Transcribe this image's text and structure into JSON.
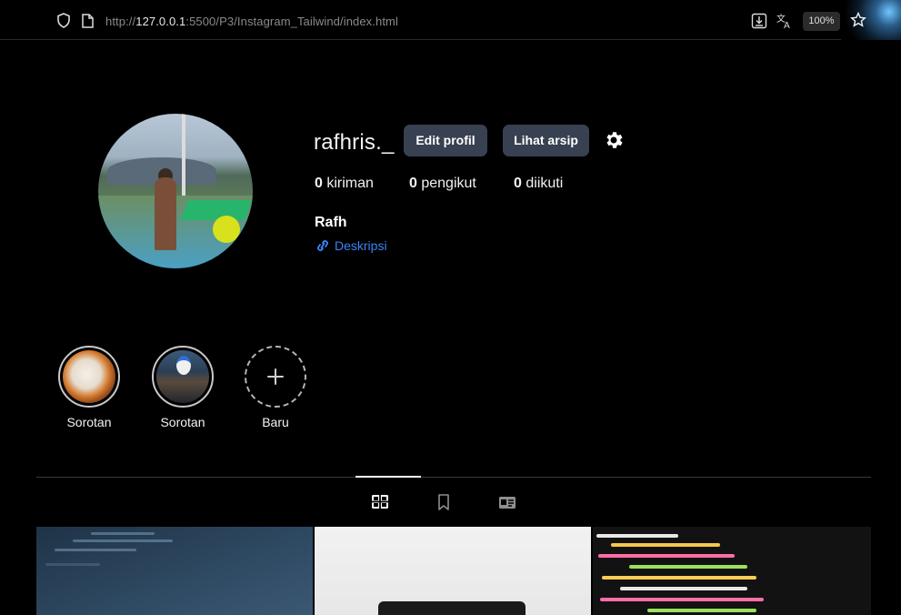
{
  "browser": {
    "url_prefix": "http://",
    "url_host": "127.0.0.1",
    "url_rest": ":5500/P3/Instagram_Tailwind/index.html",
    "zoom": "100%"
  },
  "profile": {
    "username": "rafhris._",
    "edit_button": "Edit profil",
    "archive_button": "Lihat arsip",
    "stats": [
      {
        "count": "0",
        "label": "kiriman"
      },
      {
        "count": "0",
        "label": "pengikut"
      },
      {
        "count": "0",
        "label": "diikuti"
      }
    ],
    "name": "Rafh",
    "link_text": "Deskripsi"
  },
  "highlights": [
    {
      "label": "Sorotan"
    },
    {
      "label": "Sorotan"
    },
    {
      "label": "Baru"
    }
  ],
  "tabs": {
    "icons": [
      "grid-icon",
      "bookmark-icon",
      "tagged-icon"
    ],
    "active": "grid"
  },
  "colors": {
    "button_bg": "#374151",
    "link": "#3b82f6",
    "background": "#000000"
  }
}
